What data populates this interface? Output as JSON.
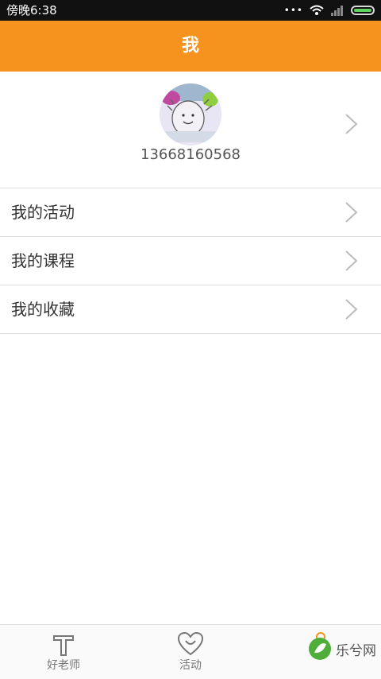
{
  "status": {
    "time": "傍晚6:38"
  },
  "header": {
    "title": "我"
  },
  "profile": {
    "phone": "13668160568"
  },
  "menu": [
    {
      "label": "我的活动"
    },
    {
      "label": "我的课程"
    },
    {
      "label": "我的收藏"
    }
  ],
  "tabs": [
    {
      "label": "好老师",
      "icon": "teacher-icon"
    },
    {
      "label": "活动",
      "icon": "heart-icon"
    },
    {
      "label": "",
      "icon": "profile-icon"
    }
  ],
  "watermark": {
    "text": "乐兮网"
  },
  "colors": {
    "accent": "#f6921e"
  }
}
